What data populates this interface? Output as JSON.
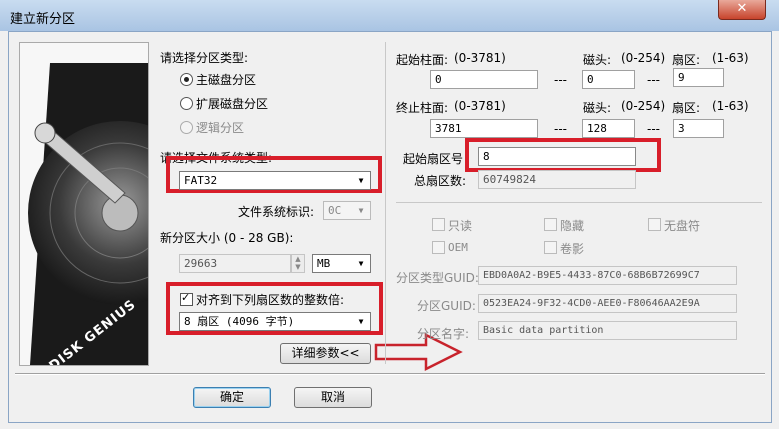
{
  "window": {
    "title": "建立新分区",
    "close": "✕"
  },
  "disk": {
    "brand": "DISK GENIUS"
  },
  "partition_type": {
    "label": "请选择分区类型:",
    "options": [
      "主磁盘分区",
      "扩展磁盘分区",
      "逻辑分区"
    ],
    "selected": "主磁盘分区"
  },
  "filesystem": {
    "label": "请选择文件系统类型:",
    "value": "FAT32"
  },
  "fs_id": {
    "label": "文件系统标识:",
    "value": "0C"
  },
  "size": {
    "label": "新分区大小 (0 - 28 GB):",
    "value": "29663",
    "unit": "MB"
  },
  "align": {
    "label": "对齐到下列扇区数的整数倍:",
    "checked": true,
    "value": "8 扇区 (4096 字节)"
  },
  "details_button": "详细参数<<",
  "start": {
    "cyl_label": "起始柱面:",
    "cyl_range": "(0-3781)",
    "cyl": "0",
    "head_label": "磁头:",
    "head_range": "(0-254)",
    "head": "0",
    "sector_label": "扇区:",
    "sector_range": "(1-63)",
    "sector": "9",
    "sep": "---"
  },
  "end": {
    "cyl_label": "终止柱面:",
    "cyl_range": "(0-3781)",
    "cyl": "3781",
    "head_label": "磁头:",
    "head_range": "(0-254)",
    "head": "128",
    "sector_label": "扇区:",
    "sector_range": "(1-63)",
    "sector": "3",
    "sep": "---"
  },
  "start_sector": {
    "label": "起始扇区号",
    "value": "8"
  },
  "total_sectors": {
    "label": "总扇区数:",
    "value": "60749824"
  },
  "attributes": [
    "只读",
    "隐藏",
    "无盘符",
    "OEM",
    "卷影"
  ],
  "guid": {
    "type_label": "分区类型GUID:",
    "type_value": "EBD0A0A2-B9E5-4433-87C0-68B6B72699C7",
    "part_label": "分区GUID:",
    "part_value": "0523EA24-9F32-4CD0-AEE0-F80646AA2E9A",
    "name_label": "分区名字:",
    "name_value": "Basic data partition"
  },
  "buttons": {
    "ok": "确定",
    "cancel": "取消"
  },
  "colors": {
    "highlight": "#d81e2a",
    "title_bar": "#b4cde9"
  }
}
